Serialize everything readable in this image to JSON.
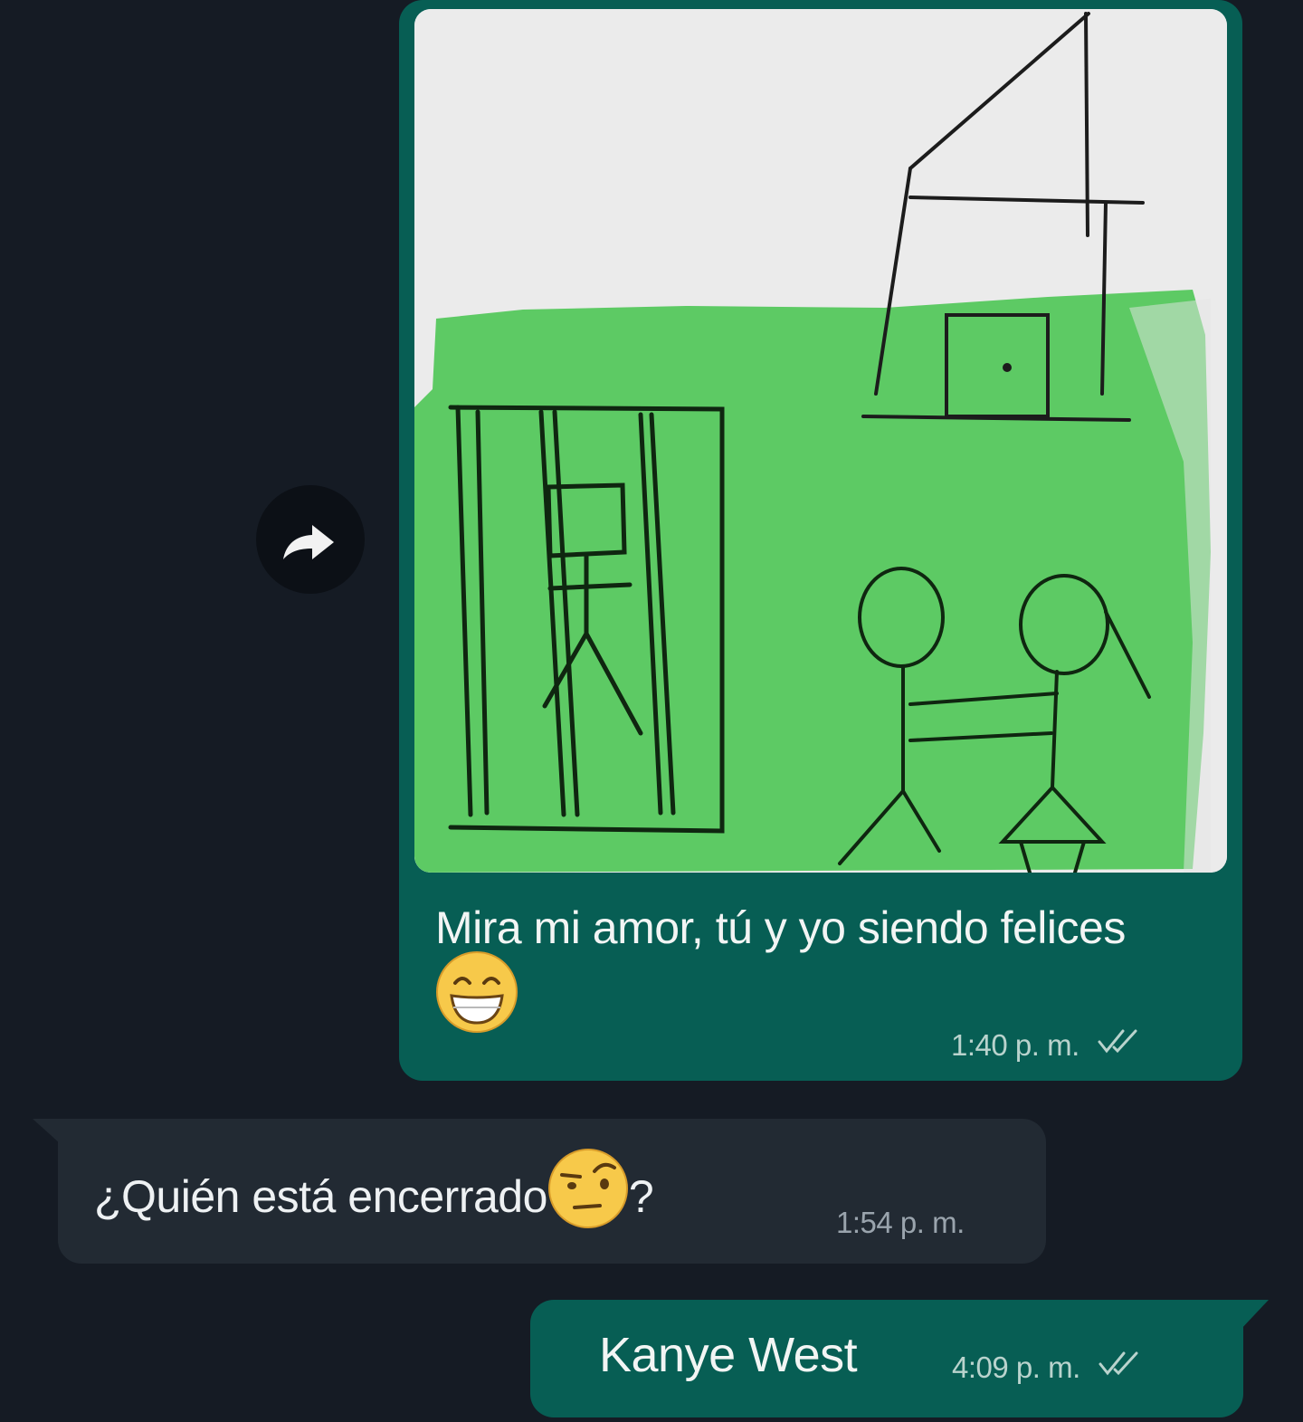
{
  "messages": {
    "image_message": {
      "caption": "Mira mi amor, tú y yo siendo felices",
      "emoji": "grinning-face-emoji",
      "time": "1:40 p. m.",
      "status": "read-double-check",
      "media": "hand-drawn-picture-house-prison-two-figures"
    },
    "incoming_message": {
      "text": "¿Quién está encerrado",
      "emoji": "face-with-raised-eyebrow-emoji",
      "suffix": "?",
      "time": "1:54 p. m."
    },
    "reply_message": {
      "text": "Kanye West",
      "time": "4:09 p. m.",
      "status": "read-double-check"
    }
  },
  "forward_button": {
    "icon": "forward-arrow-icon"
  },
  "colors": {
    "background": "#151b24",
    "outgoing_bubble": "#075e54",
    "incoming_bubble": "#222a33",
    "drawing_green": "#5dca64"
  }
}
